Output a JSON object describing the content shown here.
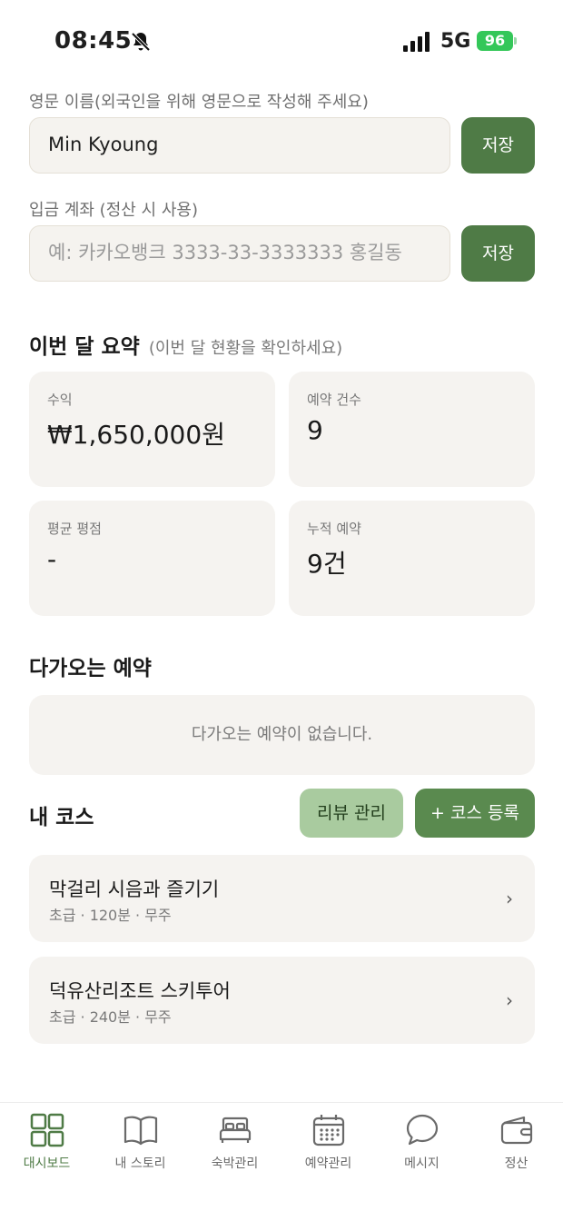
{
  "status": {
    "time": "08:45",
    "network": "5G",
    "battery": "96",
    "battery_color": "#34c759"
  },
  "english_name": {
    "label": "영문 이름(외국인을 위해 영문으로 작성해 주세요)",
    "value": "Min Kyoung",
    "save_label": "저장"
  },
  "bank_account": {
    "label": "입금 계좌 (정산 시 사용)",
    "placeholder": "예: 카카오뱅크 3333-33-3333333 홍길동",
    "save_label": "저장"
  },
  "summary": {
    "title": "이번 달 요약",
    "subtitle": "(이번 달 현황을 확인하세요)",
    "cards": [
      {
        "label": "수익",
        "value": "₩1,650,000원"
      },
      {
        "label": "예약 건수",
        "value": "9"
      },
      {
        "label": "평균 평점",
        "value": "-"
      },
      {
        "label": "누적 예약",
        "value": "9건"
      }
    ]
  },
  "upcoming": {
    "title": "다가오는 예약",
    "empty_text": "다가오는 예약이 없습니다."
  },
  "courses": {
    "title": "내 코스",
    "review_button": "리뷰 관리",
    "add_button": "+ 코스 등록",
    "items": [
      {
        "name": "막걸리 시음과 즐기기",
        "meta": "초급 · 120분 · 무주"
      },
      {
        "name": "덕유산리조트 스키투어",
        "meta": "초급 · 240분 · 무주"
      }
    ]
  },
  "tabs": [
    {
      "label": "대시보드",
      "icon": "grid-icon",
      "active": true
    },
    {
      "label": "내 스토리",
      "icon": "book-icon"
    },
    {
      "label": "숙박관리",
      "icon": "bed-icon"
    },
    {
      "label": "예약관리",
      "icon": "calendar-icon"
    },
    {
      "label": "메시지",
      "icon": "chat-bubble-icon"
    },
    {
      "label": "정산",
      "icon": "wallet-icon"
    }
  ],
  "colors": {
    "accent": "#4f7b46",
    "accent_light": "#a9cb9f",
    "card_bg": "#f5f3f0"
  }
}
